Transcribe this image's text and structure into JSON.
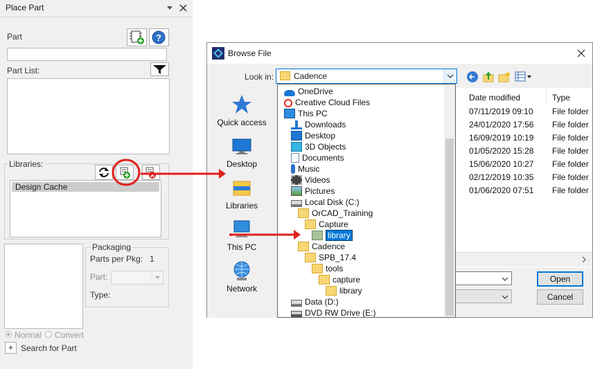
{
  "place_part": {
    "title": "Place Part",
    "part_label": "Part",
    "part_value": "",
    "part_list_label": "Part List:",
    "libraries_label": "Libraries:",
    "libraries": [
      "Design Cache"
    ],
    "packaging_label": "Packaging",
    "parts_per_pkg_label": "Parts per Pkg:",
    "parts_per_pkg_value": "1",
    "part_select_label": "Part:",
    "type_label": "Type:",
    "radio_normal": "Normal",
    "radio_convert": "Convert",
    "search_expander": "+",
    "search_label": "Search for Part"
  },
  "dialog": {
    "title": "Browse File",
    "look_in_label": "Look in:",
    "look_in_value": "Cadence",
    "places": [
      "Quick access",
      "Desktop",
      "Libraries",
      "This PC",
      "Network"
    ],
    "tree": [
      {
        "label": "OneDrive",
        "icon": "cloud-icon"
      },
      {
        "label": "Creative Cloud Files",
        "icon": "creative-cloud-icon"
      },
      {
        "label": "This PC",
        "icon": "computer-icon"
      },
      {
        "label": "Downloads",
        "icon": "download-arrow-icon"
      },
      {
        "label": "Desktop",
        "icon": "desktop-icon"
      },
      {
        "label": "3D Objects",
        "icon": "cube-icon"
      },
      {
        "label": "Documents",
        "icon": "document-icon"
      },
      {
        "label": "Music",
        "icon": "music-note-icon"
      },
      {
        "label": "Videos",
        "icon": "film-icon"
      },
      {
        "label": "Pictures",
        "icon": "picture-icon"
      },
      {
        "label": "Local Disk (C:)",
        "icon": "hard-drive-icon"
      },
      {
        "label": "OrCAD_Training",
        "icon": "folder-icon"
      },
      {
        "label": "Capture",
        "icon": "folder-icon"
      },
      {
        "label": "library",
        "icon": "folder-icon"
      },
      {
        "label": "Cadence",
        "icon": "folder-icon"
      },
      {
        "label": "SPB_17.4",
        "icon": "folder-icon"
      },
      {
        "label": "tools",
        "icon": "folder-icon"
      },
      {
        "label": "capture",
        "icon": "folder-icon"
      },
      {
        "label": "library",
        "icon": "folder-icon"
      },
      {
        "label": "Data (D:)",
        "icon": "hard-drive-icon"
      },
      {
        "label": "DVD RW Drive (E:)",
        "icon": "dvd-drive-icon"
      }
    ],
    "columns": [
      "Date modified",
      "Type"
    ],
    "rows": [
      [
        "07/11/2019 09:10",
        "File folder"
      ],
      [
        "24/01/2020 17:56",
        "File folder"
      ],
      [
        "16/09/2019 10:19",
        "File folder"
      ],
      [
        "01/05/2020 15:28",
        "File folder"
      ],
      [
        "15/06/2020 10:27",
        "File folder"
      ],
      [
        "02/12/2019 10:35",
        "File folder"
      ],
      [
        "01/06/2020 07:51",
        "File folder"
      ]
    ],
    "open_label": "Open",
    "cancel_label": "Cancel"
  },
  "colors": {
    "annotation": "#e0201b",
    "selection": "#0078d7",
    "folder": "#f7d674"
  }
}
